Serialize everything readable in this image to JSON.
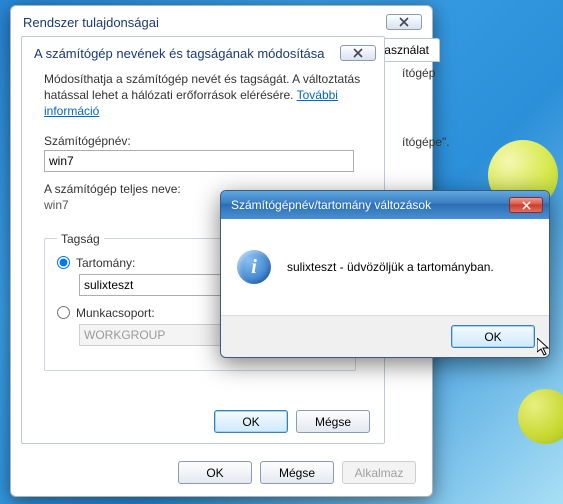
{
  "back": {
    "title": "Rendszer tulajdonságai",
    "tab_partial": "használat",
    "right_frag1": "ítógép",
    "right_frag2": "ítógépe\".",
    "btn_ok": "OK",
    "btn_cancel": "Mégse",
    "btn_apply": "Alkalmaz"
  },
  "inner": {
    "title": "A számítógép nevének és tagságának módosítása",
    "desc_prefix": "Módosíthatja a számítógép nevét és tagságát. A változtatás hatással lehet a hálózati erőforrások elérésére. ",
    "desc_link": "További információ",
    "name_label": "Számítógépnév:",
    "name_value": "win7",
    "fullname_label": "A számítógép teljes neve:",
    "fullname_value": "win7",
    "membership_legend": "Tagság",
    "domain_label": "Tartomány:",
    "domain_value": "sulixteszt",
    "workgroup_label": "Munkacsoport:",
    "workgroup_value": "WORKGROUP",
    "btn_ok": "OK",
    "btn_cancel": "Mégse"
  },
  "popup": {
    "title": "Számítógépnév/tartomány változások",
    "message": "sulixteszt - üdvözöljük a tartományban.",
    "btn_ok": "OK"
  }
}
